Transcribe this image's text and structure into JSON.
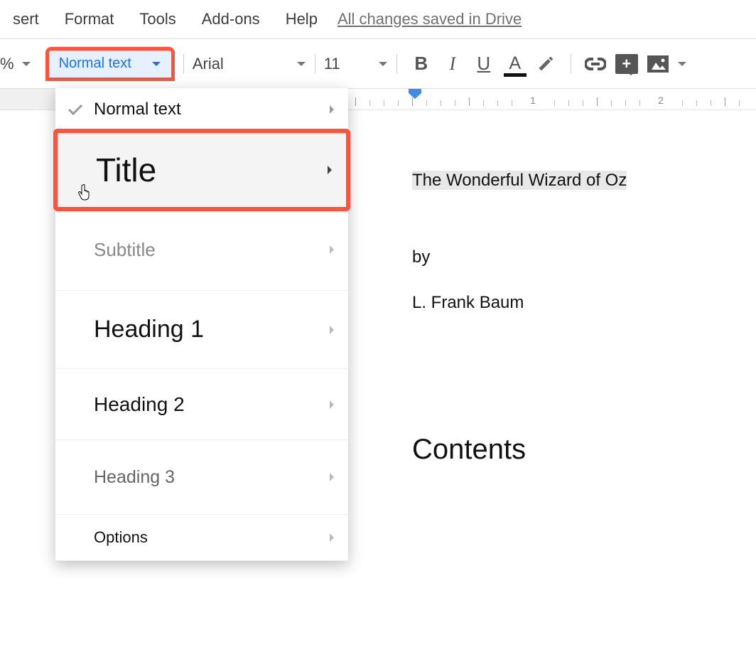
{
  "menubar": {
    "items": [
      "sert",
      "Format",
      "Tools",
      "Add-ons",
      "Help"
    ],
    "saved_label": "All changes saved in Drive"
  },
  "toolbar": {
    "zoom_label": "%",
    "style_label": "Normal text",
    "font_label": "Arial",
    "size_label": "11",
    "bold": "B",
    "italic": "I",
    "underline": "U",
    "textcolor": "A"
  },
  "ruler": {
    "labels": [
      "1",
      "2"
    ]
  },
  "dropdown": {
    "items": [
      {
        "label": "Normal text",
        "checked": true
      },
      {
        "label": "Title"
      },
      {
        "label": "Subtitle"
      },
      {
        "label": "Heading 1"
      },
      {
        "label": "Heading 2"
      },
      {
        "label": "Heading 3"
      },
      {
        "label": "Options"
      }
    ]
  },
  "document": {
    "title_text": "The Wonderful Wizard of Oz",
    "by": "by",
    "author": "L. Frank Baum",
    "contents": "Contents"
  }
}
